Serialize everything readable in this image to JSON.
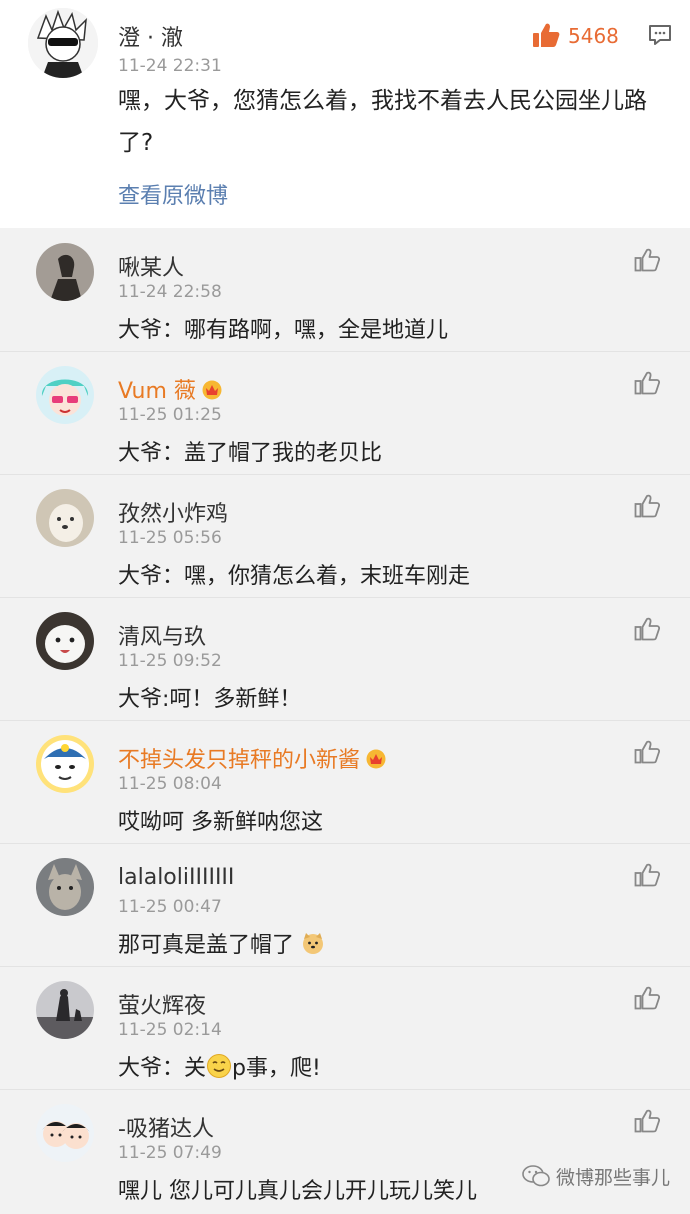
{
  "post": {
    "username": "澄 · 澈",
    "time": "11-24 22:31",
    "likes": "5468",
    "text": "嘿，大爷，您猜怎么着，我找不着去人民公园坐儿路了?",
    "view_original": "查看原微博"
  },
  "comments": [
    {
      "username": "啾某人",
      "time": "11-24 22:58",
      "text": "大爷：哪有路啊，嘿，全是地道儿",
      "vip": false
    },
    {
      "username": "Vum 薇",
      "time": "11-25 01:25",
      "text": "大爷：盖了帽了我的老贝比",
      "vip": true
    },
    {
      "username": "孜然小炸鸡",
      "time": "11-25 05:56",
      "text": "大爷：嘿，你猜怎么着，末班车刚走",
      "vip": false
    },
    {
      "username": "清风与玖",
      "time": "11-25 09:52",
      "text": "大爷:呵！多新鲜！",
      "vip": false
    },
    {
      "username": "不掉头发只掉秤的小新酱",
      "time": "11-25 08:04",
      "text": "哎呦呵 多新鲜呐您这",
      "vip": true
    },
    {
      "username": "lalaloliIIIIIII",
      "time": "11-25 00:47",
      "text": "那可真是盖了帽了",
      "vip": false
    },
    {
      "username": "萤火辉夜",
      "time": "11-25 02:14",
      "text_before": "大爷：关",
      "text_after": "p事，爬!",
      "vip": false
    },
    {
      "username": "-吸猪达人",
      "time": "11-25 07:49",
      "text": "嘿儿 您儿可儿真儿会儿开儿玩儿笑儿",
      "vip": false
    }
  ],
  "watermark": "微博那些事儿",
  "colors": {
    "vip_name": "#e87a24",
    "like_count": "#e86b34",
    "link": "#5b7fb0"
  }
}
